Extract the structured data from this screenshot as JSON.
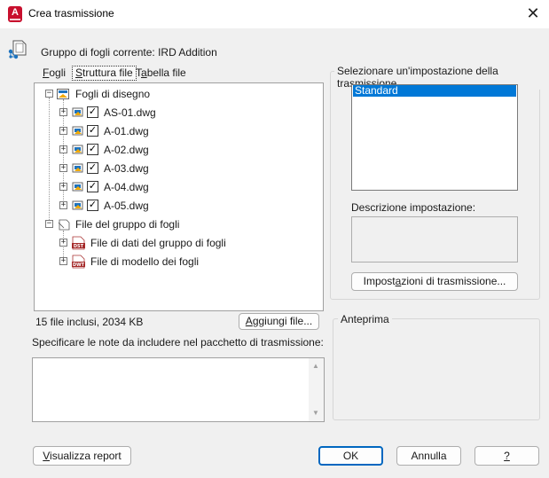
{
  "window": {
    "title": "Crea trasmissione",
    "close_symbol": "✕",
    "app_icon": "autocad-icon",
    "app_icon_letter": "A"
  },
  "current_sheet_set": "Gruppo di fogli corrente: IRD Addition",
  "tabs": [
    {
      "pre": "",
      "key": "F",
      "post": "ogli"
    },
    {
      "pre": "",
      "key": "S",
      "post": "truttura file"
    },
    {
      "pre": "T",
      "key": "a",
      "post": "bella file"
    }
  ],
  "tree": {
    "root1": {
      "label": "Fogli di disegno"
    },
    "files": [
      {
        "label": "AS-01.dwg",
        "checked": true
      },
      {
        "label": "A-01.dwg",
        "checked": true
      },
      {
        "label": "A-02.dwg",
        "checked": true
      },
      {
        "label": "A-03.dwg",
        "checked": true
      },
      {
        "label": "A-04.dwg",
        "checked": true
      },
      {
        "label": "A-05.dwg",
        "checked": true
      }
    ],
    "root2": {
      "label": "File del gruppo di fogli"
    },
    "sub": [
      {
        "label": "File di dati del gruppo di fogli",
        "badge": "DST"
      },
      {
        "label": "File di modello dei fogli",
        "badge": "DWT"
      }
    ],
    "expander_plus": "+",
    "expander_minus": "−",
    "check_mark": "✓"
  },
  "status": "15 file inclusi, 2034 KB",
  "add_file_button": {
    "key": "A",
    "post": "ggiungi file..."
  },
  "notes_label": "Specificare le note da includere nel pacchetto di trasmissione:",
  "notes_value": "",
  "scroll": {
    "up": "▲",
    "down": "▼"
  },
  "setup_group": {
    "title": "Selezionare un'impostazione della trasmissione",
    "items": [
      "Standard"
    ],
    "selected": "Standard",
    "description_label": "Descrizione impostazione:",
    "description_value": "",
    "settings_button": {
      "pre": "Impost",
      "key": "a",
      "post": "zioni di trasmissione..."
    }
  },
  "preview_group": {
    "title": "Anteprima"
  },
  "buttons": {
    "report": {
      "key": "V",
      "post": "isualizza report"
    },
    "ok": "OK",
    "cancel": "Annulla",
    "help": "?"
  },
  "colors": {
    "selection": "#0078d7",
    "ok_border": "#0067c0",
    "autocad_red": "#c8102e"
  }
}
